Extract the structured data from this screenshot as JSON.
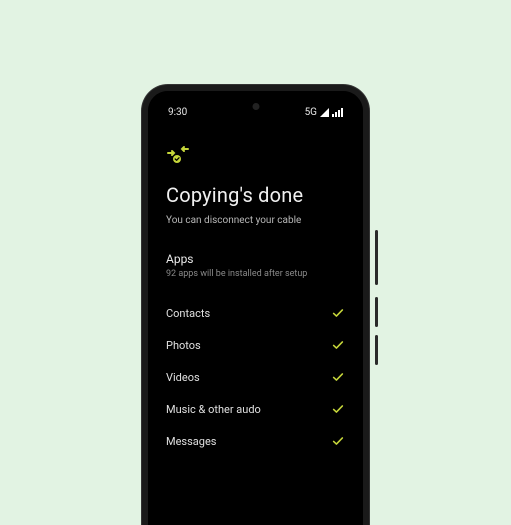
{
  "statusbar": {
    "time": "9:30",
    "network": "5G"
  },
  "accent": "#c6d63a",
  "header": {
    "title": "Copying's done",
    "subtitle": "You can disconnect your cable"
  },
  "apps": {
    "label": "Apps",
    "detail": "92 apps will be installed after setup"
  },
  "items": [
    {
      "label": "Contacts"
    },
    {
      "label": "Photos"
    },
    {
      "label": "Videos"
    },
    {
      "label": "Music & other audo"
    },
    {
      "label": "Messages"
    }
  ]
}
